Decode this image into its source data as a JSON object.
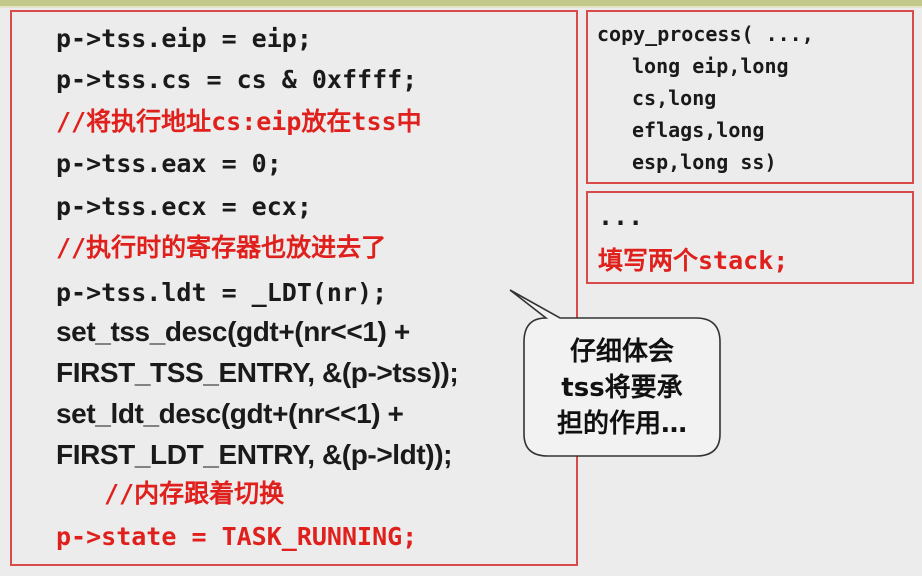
{
  "code_lines": [
    "p->tss.eip = eip;",
    "p->tss.cs = cs & 0xffff;",
    "//将执行地址cs:eip放在tss中",
    "p->tss.eax = 0;",
    "p->tss.ecx = ecx;",
    "//执行时的寄存器也放进去了",
    "p->tss.ldt = _LDT(nr);",
    "set_tss_desc(gdt+(nr<<1) +",
    "FIRST_TSS_ENTRY, &(p->tss));",
    "set_ldt_desc(gdt+(nr<<1) +",
    "FIRST_LDT_ENTRY, &(p->ldt));",
    "//内存跟着切换",
    "p->state = TASK_RUNNING;"
  ],
  "signature_lines": [
    "copy_process( ...,",
    "long eip,long",
    "cs,long",
    "eflags,long",
    "esp,long ss)"
  ],
  "stack_box": {
    "ellipsis": "...",
    "text": "填写两个stack;"
  },
  "callout": {
    "lines": [
      "仔细体会",
      "tss将要承",
      "担的作用…"
    ]
  },
  "colors": {
    "red": "#e0201c",
    "border": "#d94a4a",
    "background": "#ececec"
  }
}
